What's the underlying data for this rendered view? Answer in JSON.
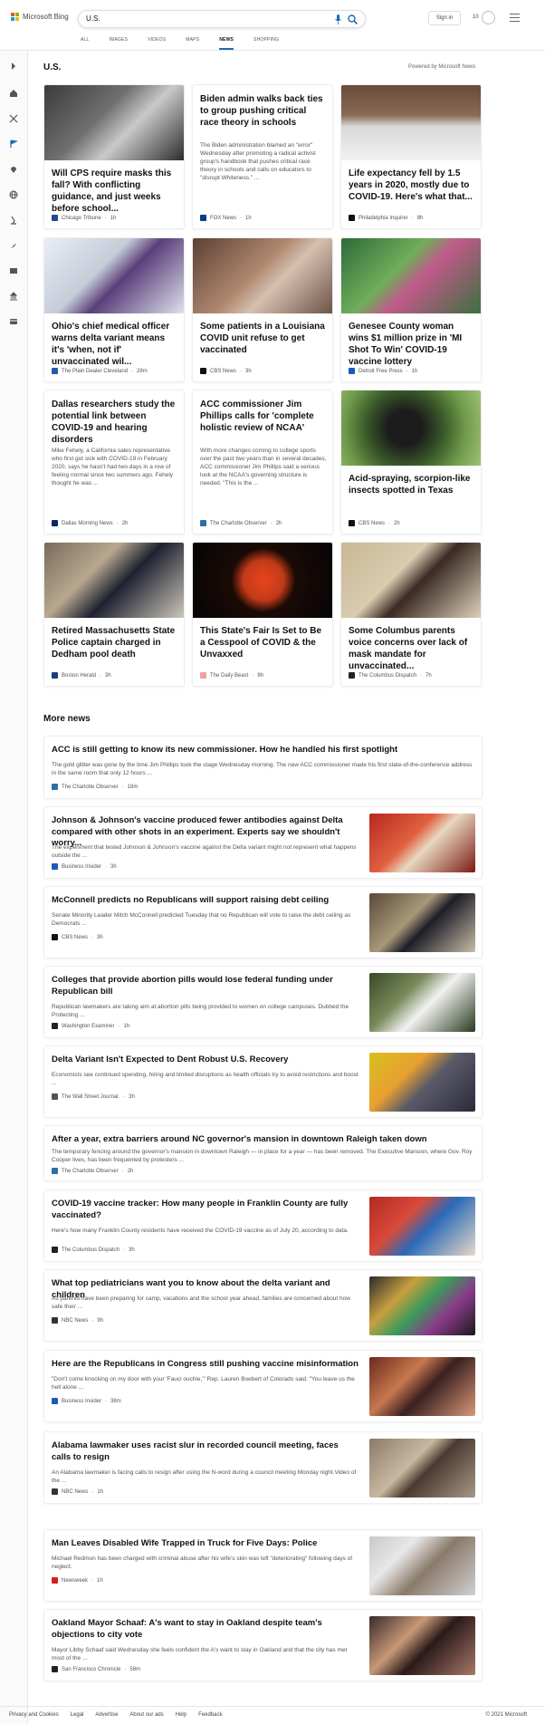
{
  "header": {
    "brand": "Microsoft Bing",
    "search_value": "U.S.",
    "sign_in": "Sign in",
    "rewards_count": "10",
    "tabs": [
      "ALL",
      "IMAGES",
      "VIDEOS",
      "MAPS",
      "NEWS",
      "SHOPPING"
    ],
    "active_tab": "NEWS",
    "colors": {
      "accent": "#1f6ab6"
    }
  },
  "section": {
    "title": "U.S.",
    "powered": "Powered by Microsoft News"
  },
  "cards": [
    {
      "title": "Will CPS require masks this fall? With conflicting guidance, and just weeks before school...",
      "excerpt": "",
      "source": "Chicago Tribune",
      "time": "1h",
      "has_image": true
    },
    {
      "title": "Biden admin walks back ties to group pushing critical race theory in schools",
      "excerpt": "The Biden administration blamed an \"error\" Wednesday after promoting a radical activist group's handbook that pushes critical race theory in schools and calls on educators to \"disrupt Whiteness.\" ...",
      "source": "FOX News",
      "time": "1h",
      "has_image": false
    },
    {
      "title": "Life expectancy fell by 1.5 years in 2020, mostly due to COVID-19. Here's what that...",
      "excerpt": "",
      "source": "Philadelphia Inquirer",
      "time": "8h",
      "has_image": true
    },
    {
      "title": "Ohio's chief medical officer warns delta variant means it's 'when, not if' unvaccinated wil...",
      "excerpt": "",
      "source": "The Plain Dealer Cleveland",
      "time": "28m",
      "has_image": true
    },
    {
      "title": "Some patients in a Louisiana COVID unit refuse to get vaccinated",
      "excerpt": "",
      "source": "CBS News",
      "time": "3h",
      "has_image": true
    },
    {
      "title": "Genesee County woman wins $1 million prize in 'MI Shot To Win' COVID-19 vaccine lottery",
      "excerpt": "",
      "source": "Detroit Free Press",
      "time": "1h",
      "has_image": true
    },
    {
      "title": "Dallas researchers study the potential link between COVID-19 and hearing disorders",
      "excerpt": "Mike Fehely, a California sales representative who first got sick with COVID-19 in February 2020, says he hasn't had two days in a row of feeling normal since two summers ago. Fehely thought he was ...",
      "source": "Dallas Morning News",
      "time": "2h",
      "has_image": false
    },
    {
      "title": "ACC commissioner Jim Phillips calls for 'complete holistic review of NCAA'",
      "excerpt": "With more changes coming to college sports over the past two years than in several decades, ACC commissioner Jim Phillips said a serious look at the NCAA's governing structure is needed. \"This is the ...",
      "source": "The Charlotte Observer",
      "time": "2h",
      "has_image": false
    },
    {
      "title": "Acid-spraying, scorpion-like insects spotted in Texas",
      "excerpt": "",
      "source": "CBS News",
      "time": "2h",
      "has_image": true
    },
    {
      "title": "Retired Massachusetts State Police captain charged in Dedham pool death",
      "excerpt": "",
      "source": "Boston Herald",
      "time": "3h",
      "has_image": true
    },
    {
      "title": "This State's Fair Is Set to Be a Cesspool of COVID & the Unvaxxed",
      "excerpt": "",
      "source": "The Daily Beast",
      "time": "8h",
      "has_image": true
    },
    {
      "title": "Some Columbus parents voice concerns over lack of mask mandate for unvaccinated...",
      "excerpt": "",
      "source": "The Columbus Dispatch",
      "time": "7h",
      "has_image": true
    }
  ],
  "more_news": {
    "title": "More news",
    "items": [
      {
        "title": "ACC is still getting to know its new commissioner. How he handled his first spotlight",
        "excerpt": "The gold glitter was gone by the time Jim Phillips took the stage Wednesday morning. The new ACC commissioner made his first state-of-the-conference address in the same room that only 12 hours ...",
        "source": "The Charlotte Observer",
        "time": "18m"
      },
      {
        "title": "Johnson & Johnson's vaccine produced fewer antibodies against Delta compared with other shots in an experiment. Experts say we shouldn't worry...",
        "excerpt": "The experiment that tested Johnson & Johnson's vaccine against the Delta variant might not represent what happens outside the ...",
        "source": "Business Insider",
        "time": "3h"
      },
      {
        "title": "McConnell predicts no Republicans will support raising debt ceiling",
        "excerpt": "Senate Minority Leader Mitch McConnell predicted Tuesday that no Republican will vote to raise the debt ceiling as Democrats ...",
        "source": "CBS News",
        "time": "3h"
      },
      {
        "title": "Colleges that provide abortion pills would lose federal funding under Republican bill",
        "excerpt": "Republican lawmakers are taking aim at abortion pills being provided to women on college campuses. Dubbed the Protecting ...",
        "source": "Washington Examiner",
        "time": "1h"
      },
      {
        "title": "Delta Variant Isn't Expected to Dent Robust U.S. Recovery",
        "excerpt": "Economists see continued spending, hiring and limited disruptions as health officials try to avoid restrictions and boost ...",
        "source": "The Wall Street Journal.",
        "time": "3h"
      },
      {
        "title": "After a year, extra barriers around NC governor's mansion in downtown Raleigh taken down",
        "excerpt": "The temporary fencing around the governor's mansion in downtown Raleigh — in place for a year — has been removed. The Executive Mansion, where Gov. Roy Cooper lives, has been frequented by protesters ...",
        "source": "The Charlotte Observer",
        "time": "2h"
      },
      {
        "title": "COVID-19 vaccine tracker: How many people in Franklin County are fully vaccinated?",
        "excerpt": "Here's how many Franklin County residents have received the COVID-19 vaccine as of July 20, according to data.",
        "source": "The Columbus Dispatch",
        "time": "3h"
      },
      {
        "title": "What top pediatricians want you to know about the delta variant and children",
        "excerpt": "As parents have been preparing for camp, vacations and the school year ahead, families are concerned about how safe their ...",
        "source": "NBC News",
        "time": "9h"
      },
      {
        "title": "Here are the Republicans in Congress still pushing vaccine misinformation",
        "excerpt": "\"Don't come knocking on my door with your 'Fauci ouchie,'\" Rep. Lauren Boebert of Colorado said. \"You leave us the hell alone ...",
        "source": "Business Insider",
        "time": "38m"
      },
      {
        "title": "Alabama lawmaker uses racist slur in recorded council meeting, faces calls to resign",
        "excerpt": "An Alabama lawmaker is facing calls to resign after using the N-word during a council meeting Monday night.Video of the ...",
        "source": "NBC News",
        "time": "1h"
      },
      {
        "title": "Man Leaves Disabled Wife Trapped in Truck for Five Days: Police",
        "excerpt": "Michael Redmon has been charged with criminal abuse after his wife's skin was left \"deteriorating\" following days of neglect.",
        "source": "Newsweek",
        "time": "1h"
      },
      {
        "title": "Oakland Mayor Schaaf: A's want to stay in Oakland despite team's objections to city vote",
        "excerpt": "Mayor Libby Schaaf said Wednesday she feels confident the A's want to stay in Oakland and that the city has met most of the ...",
        "source": "San Francisco Chronicle",
        "time": "58m"
      }
    ]
  },
  "footer": {
    "links": [
      "Privacy and Cookies",
      "Legal",
      "Advertise",
      "About our ads",
      "Help",
      "Feedback"
    ],
    "copyright": "© 2021 Microsoft"
  }
}
